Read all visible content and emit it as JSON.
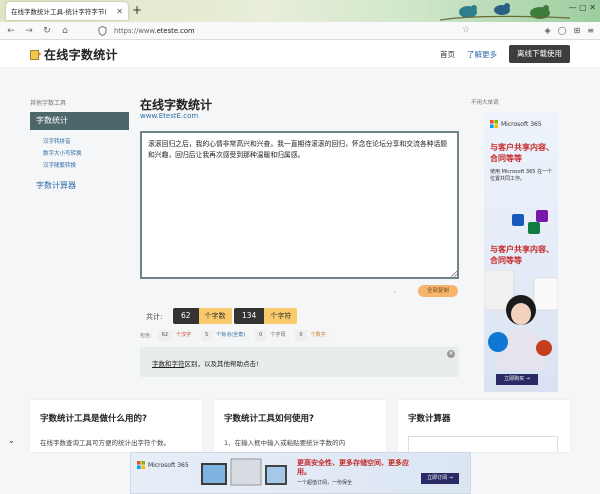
{
  "browser": {
    "tab_title": "在线字数统计工具-统计字符字节(",
    "tab_close": "✕",
    "new_tab": "+",
    "url_prefix": "https://www.",
    "url_domain": "eteste.com",
    "window_controls": "— ▢ ✕"
  },
  "header": {
    "logo_text": "在线字数统计",
    "nav": [
      "首页",
      "了解更多"
    ],
    "download_button": "离线下载使用"
  },
  "sidebar": {
    "heading": "其他字数工具",
    "active_item": "字数统计",
    "sub_items": [
      "汉字转拼音",
      "数字大小写转换",
      "汉字随繁转换"
    ],
    "second_item": "字数计算器"
  },
  "main": {
    "title": "在线字数统计",
    "subtitle": "www.EtestE.com",
    "text": "滚滚回归之后，我的心情非常高兴和兴奋。我一直期待滚滚的回归，怀念在论坛分享和交流各种话题和兴趣，回归后让我再次感受到那种温暖和归属感。",
    "copy_button": "全部复制",
    "total_label": "共计:",
    "stats": [
      {
        "value": "62",
        "unit": "个字数"
      },
      {
        "value": "134",
        "unit": "个字符"
      }
    ],
    "detail_label": "包含:",
    "details": [
      {
        "value": "62",
        "unit": "个汉字",
        "color": "#d2452e"
      },
      {
        "value": "5",
        "unit": "个标点(全角)",
        "color": "#2e6aa8"
      },
      {
        "value": "0",
        "unit": "个字母",
        "color": "#666666"
      },
      {
        "value": "0",
        "unit": "个数字",
        "color": "#c97a1e"
      }
    ],
    "info_text_highlight": "字数和字符",
    "info_text_rest": "区别，以及其他帮助点击!"
  },
  "ad": {
    "label": "不用大单调",
    "brand": "Microsoft 365",
    "headline1": "与客户共享内容、合同等等",
    "body1": "使用 Microsoft 365 在一个位置共同工作。",
    "headline2": "与客户共享内容、合同等等",
    "button": "立即购买 →"
  },
  "cards": [
    {
      "title": "字数统计工具是做什么用的?",
      "text": "在线字数查询工具可方便的统计出字符个数。"
    },
    {
      "title": "字数统计工具如何使用?",
      "text": "1、在输入框中输入或粘贴要统计字数的内"
    },
    {
      "title": "字数计算器",
      "text": ""
    }
  ],
  "banner": {
    "brand": "Microsoft 365",
    "headline": "更高安全性、更多存储空间、更多应用。",
    "sub": "一个超值订阅，一份保全",
    "button": "立即订阅 →"
  },
  "colors": {
    "accent": "#4d6669",
    "link": "#2e6aa8",
    "highlight": "#f9c96a",
    "copy_button": "#f6b46c"
  }
}
